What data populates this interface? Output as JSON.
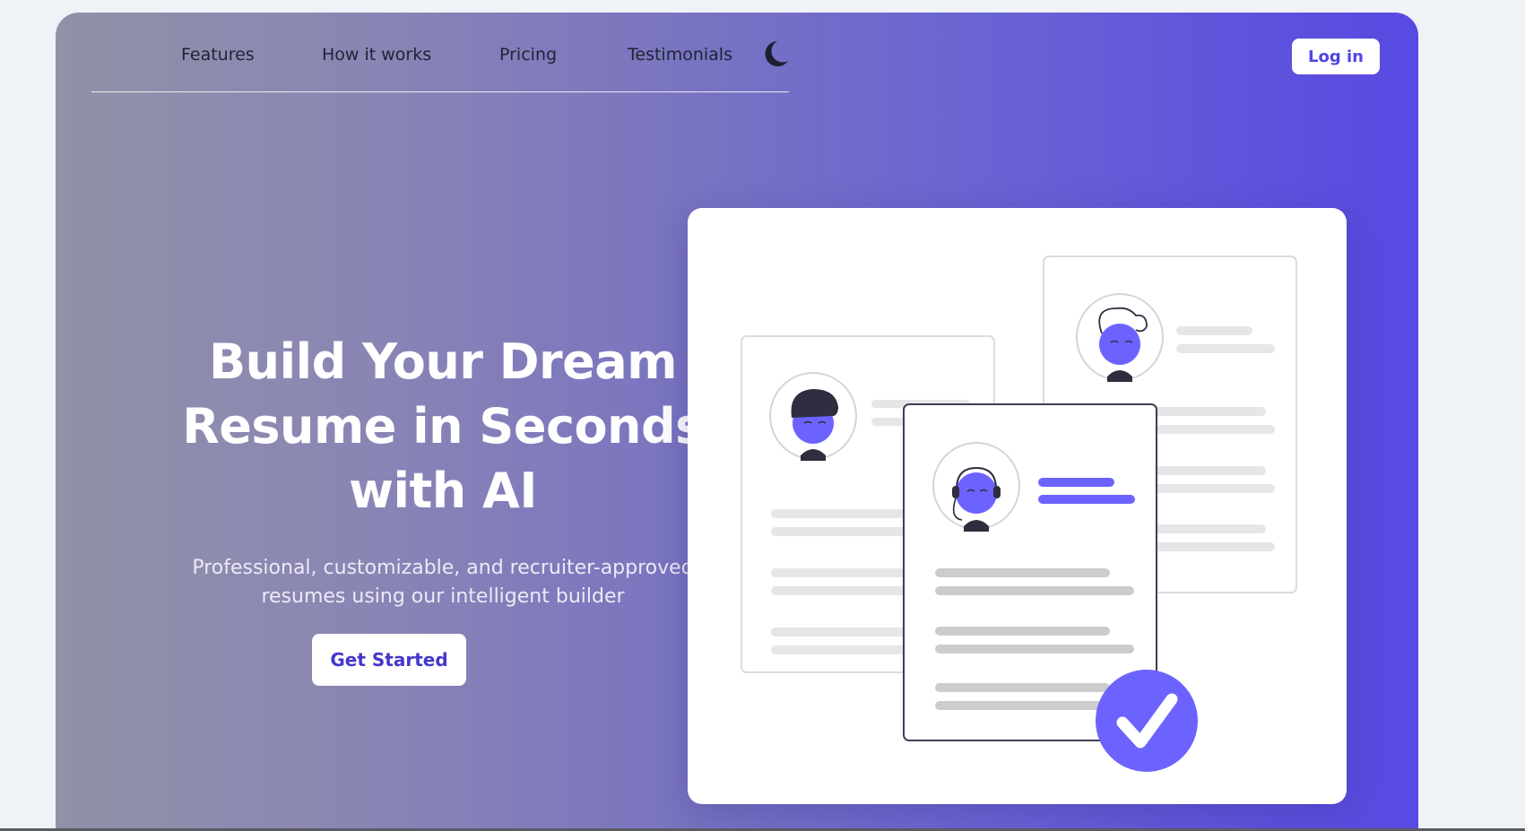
{
  "nav": {
    "items": [
      "Features",
      "How it works",
      "Pricing",
      "Testimonials"
    ],
    "theme_toggle_icon": "moon-icon",
    "login_label": "Log in"
  },
  "hero": {
    "headline_line1": "Build Your Dream",
    "headline_line2": "Resume in Seconds",
    "headline_line3": "with AI",
    "subtitle_line1": "Professional, customizable, and recruiter-approved",
    "subtitle_line2": "resumes using our intelligent builder",
    "cta_label": "Get Started"
  },
  "illustration": {
    "icons": [
      "resume-document-icon",
      "avatar-icon",
      "checkmark-icon"
    ],
    "accent_color": "#6c63ff"
  },
  "colors": {
    "brand": "#4f46e5",
    "gradient_start": "#9191a8",
    "gradient_end": "#5849e2",
    "nav_text": "#1f2333"
  }
}
